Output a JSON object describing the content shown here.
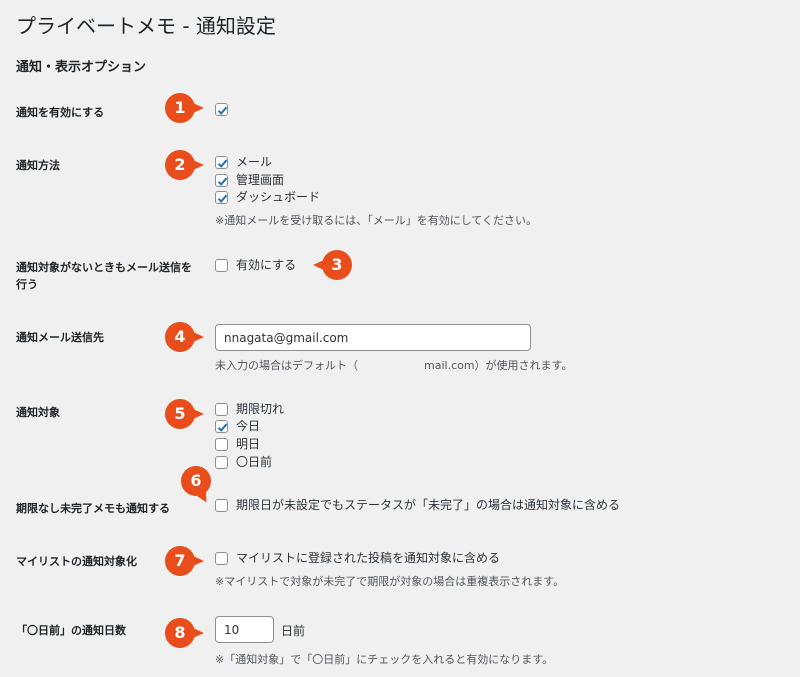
{
  "page": {
    "title": "プライベートメモ - 通知設定"
  },
  "section": {
    "title": "通知・表示オプション"
  },
  "rows": {
    "enable": {
      "label": "通知を有効にする",
      "checked": true,
      "badge": "1"
    },
    "method": {
      "label": "通知方法",
      "badge": "2",
      "options": [
        {
          "label": "メール",
          "checked": true
        },
        {
          "label": "管理画面",
          "checked": true
        },
        {
          "label": "ダッシュボード",
          "checked": true
        }
      ],
      "note": "※通知メールを受け取るには、「メール」を有効にしてください。"
    },
    "send_empty": {
      "label": "通知対象がないときもメール送信を行う",
      "badge": "3",
      "option": {
        "label": "有効にする",
        "checked": false
      }
    },
    "email": {
      "label": "通知メール送信先",
      "badge": "4",
      "value": "nnagata@gmail.com",
      "note_prefix": "未入力の場合はデフォルト（",
      "note_suffix": "mail.com）が使用されます。"
    },
    "targets": {
      "label": "通知対象",
      "badge": "5",
      "options": [
        {
          "label": "期限切れ",
          "checked": false
        },
        {
          "label": "今日",
          "checked": true
        },
        {
          "label": "明日",
          "checked": false
        },
        {
          "label": "〇日前",
          "checked": false
        }
      ]
    },
    "no_deadline": {
      "label": "期限なし未完了メモも通知する",
      "badge": "6",
      "option": {
        "label": "期限日が未設定でもステータスが「未完了」の場合は通知対象に含める",
        "checked": false
      }
    },
    "mylist": {
      "label": "マイリストの通知対象化",
      "badge": "7",
      "option": {
        "label": "マイリストに登録された投稿を通知対象に含める",
        "checked": false
      },
      "note": "※マイリストで対象が未完了で期限が対象の場合は重複表示されます。"
    },
    "days": {
      "label": "「〇日前」の通知日数",
      "badge": "8",
      "value": "10",
      "unit": "日前",
      "note": "※「通知対象」で「〇日前」にチェックを入れると有効になります。"
    }
  },
  "colors": {
    "badge": "#ea4d1c",
    "checkmark": "#2271b1",
    "background": "#f0f0f1"
  }
}
